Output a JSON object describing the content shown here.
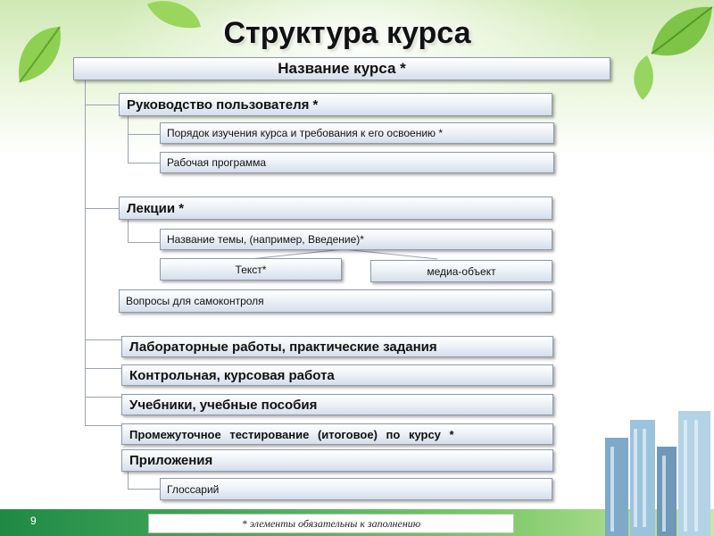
{
  "title": "Структура курса",
  "course_name": "Название курса *",
  "user_guide": {
    "label": "Руководство пользователя *",
    "items": [
      "Порядок изучения курса и требования к его освоению *",
      "Рабочая программа"
    ]
  },
  "lectures": {
    "label": "Лекции *",
    "topic": "Название темы, (например, Введение)*",
    "text": "Текст*",
    "media": "медиа-объект",
    "self_check": "Вопросы для самоконтроля"
  },
  "sections": [
    "Лабораторные работы, практические задания",
    "Контрольная, курсовая работа",
    "Учебники, учебные пособия",
    "Промежуточное тестирование (итоговое) по курсу *",
    "Приложения"
  ],
  "glossary": "Глоссарий",
  "note": "* элементы обязательны к заполнению",
  "page_number": "9",
  "colors": {
    "band": "#2e9a4d",
    "box_border": "#8e9aac"
  }
}
